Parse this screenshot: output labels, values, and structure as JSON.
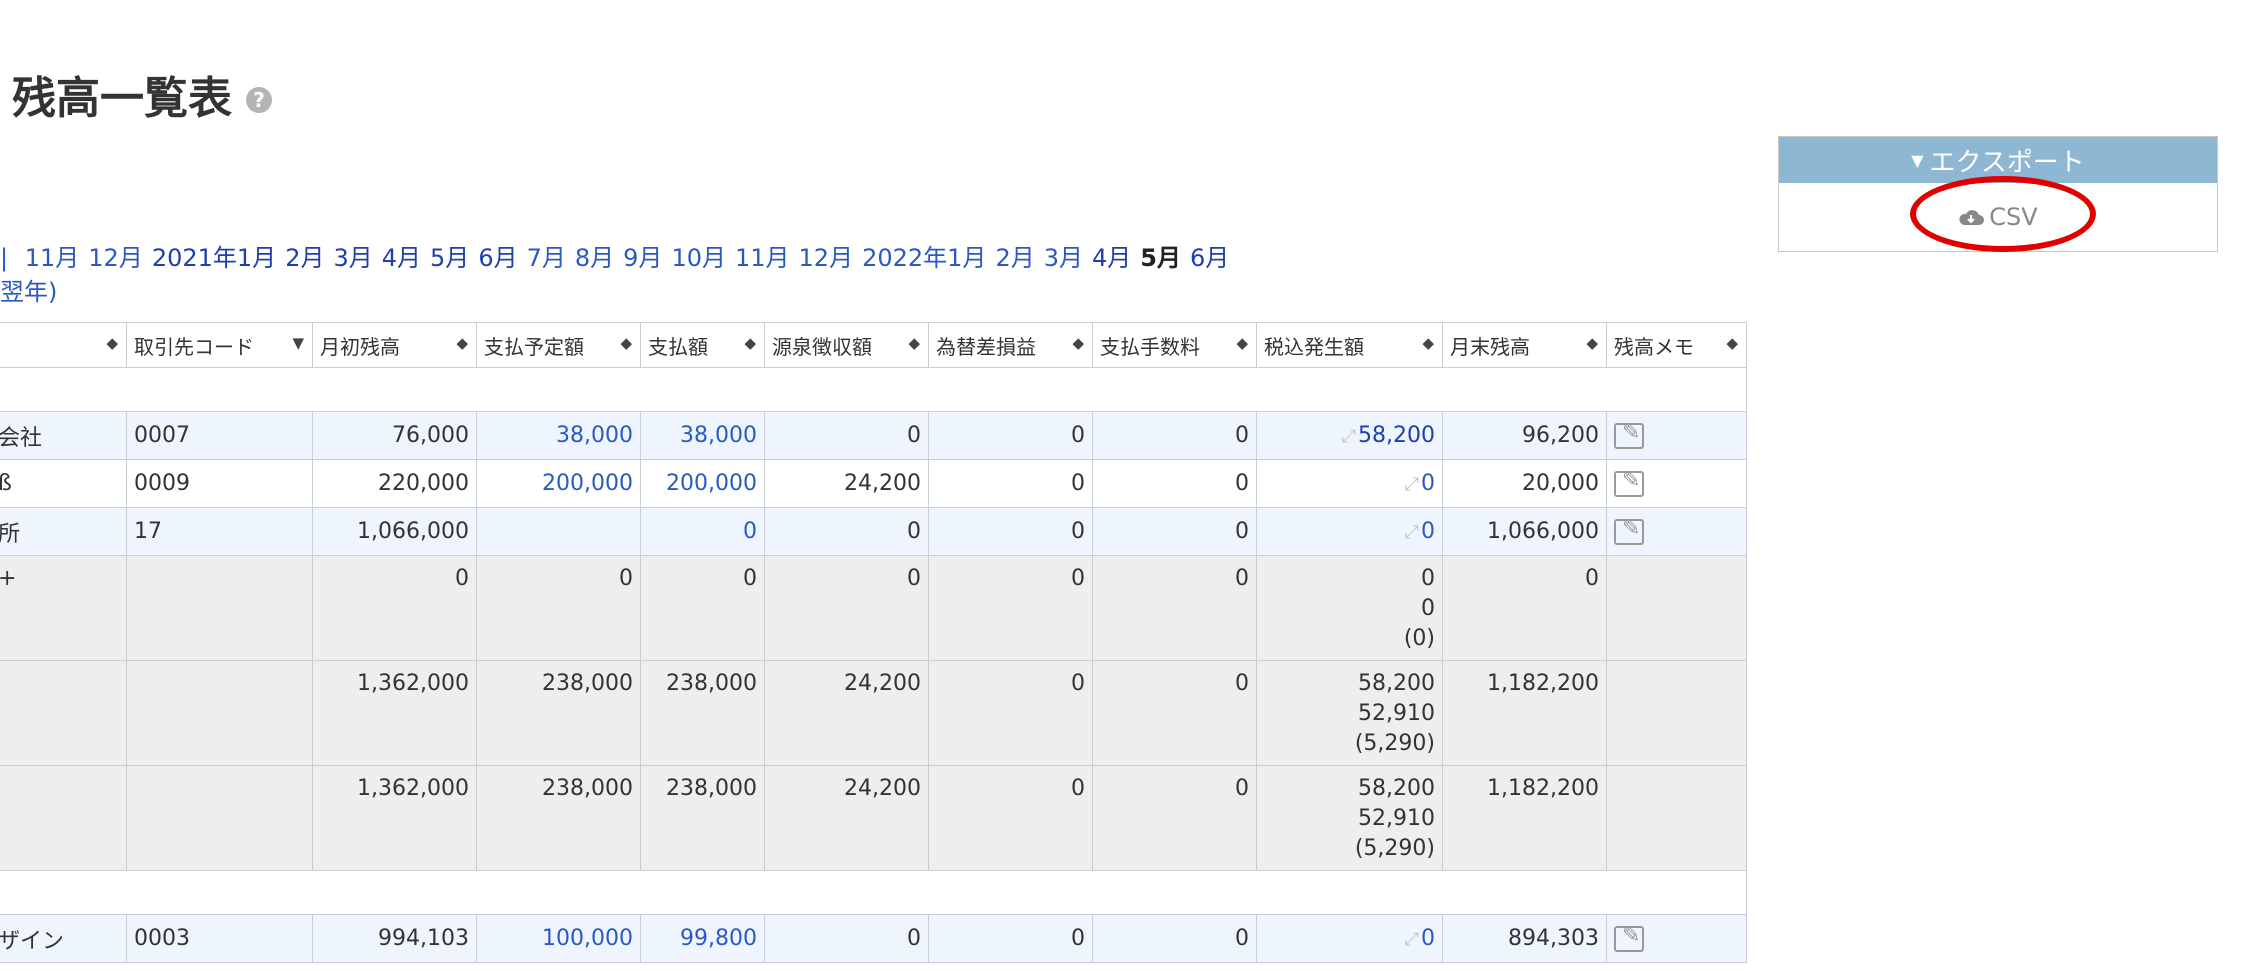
{
  "page": {
    "title": "残高一覧表",
    "help_icon": "?"
  },
  "export": {
    "header": "エクスポート",
    "csv_label": "CSV"
  },
  "months": [
    {
      "label": "11月",
      "style": "link"
    },
    {
      "label": "12月",
      "style": "link"
    },
    {
      "label": "2021年1月",
      "style": "dark"
    },
    {
      "label": "2月",
      "style": "dark"
    },
    {
      "label": "3月",
      "style": "dark"
    },
    {
      "label": "4月",
      "style": "dark"
    },
    {
      "label": "5月",
      "style": "dark"
    },
    {
      "label": "6月",
      "style": "dark"
    },
    {
      "label": "7月",
      "style": "link"
    },
    {
      "label": "8月",
      "style": "link"
    },
    {
      "label": "9月",
      "style": "link"
    },
    {
      "label": "10月",
      "style": "link"
    },
    {
      "label": "11月",
      "style": "link"
    },
    {
      "label": "12月",
      "style": "link"
    },
    {
      "label": "2022年1月",
      "style": "link"
    },
    {
      "label": "2月",
      "style": "link"
    },
    {
      "label": "3月",
      "style": "link"
    },
    {
      "label": "4月",
      "style": "dark"
    },
    {
      "label": "5月",
      "style": "current"
    },
    {
      "label": "6月",
      "style": "dark"
    }
  ],
  "months_prefix": "|",
  "subnote": "翌年)",
  "table": {
    "headers": [
      "",
      "取引先コード",
      "月初残高",
      "支払予定額",
      "支払額",
      "源泉徴収額",
      "為替差損益",
      "支払手数料",
      "税込発生額",
      "月末残高",
      "残高メモ"
    ],
    "sort_icons": [
      "◆",
      "▼",
      "◆",
      "◆",
      "◆",
      "◆",
      "◆",
      "◆",
      "◆",
      "◆",
      "◆"
    ],
    "rows": [
      {
        "type": "data",
        "bg": "blue",
        "name": "会社",
        "code": "0007",
        "open": "76,000",
        "planned": "38,000",
        "paid": "38,000",
        "withheld": "0",
        "fx": "0",
        "fee": "0",
        "tax": "58,200",
        "close": "96,200",
        "tax_link": true
      },
      {
        "type": "data",
        "bg": "white",
        "name": "ß",
        "code": "0009",
        "open": "220,000",
        "planned": "200,000",
        "paid": "200,000",
        "withheld": "24,200",
        "fx": "0",
        "fee": "0",
        "tax": "0",
        "close": "20,000",
        "tax_link": false
      },
      {
        "type": "data",
        "bg": "blue",
        "name": "所",
        "code": "17",
        "open": "1,066,000",
        "planned": "",
        "paid": "0",
        "withheld": "0",
        "fx": "0",
        "fee": "0",
        "tax": "0",
        "close": "1,066,000",
        "tax_link": false
      }
    ],
    "subtotal": {
      "name": "+",
      "open": "0",
      "planned": "0",
      "paid": "0",
      "withheld": "0",
      "fx": "0",
      "fee": "0",
      "tax_lines": [
        "0",
        "0",
        "(0)"
      ],
      "close": "0"
    },
    "total1": {
      "open": "1,362,000",
      "planned": "238,000",
      "paid": "238,000",
      "withheld": "24,200",
      "fx": "0",
      "fee": "0",
      "tax_lines": [
        "58,200",
        "52,910",
        "(5,290)"
      ],
      "close": "1,182,200"
    },
    "total2": {
      "open": "1,362,000",
      "planned": "238,000",
      "paid": "238,000",
      "withheld": "24,200",
      "fx": "0",
      "fee": "0",
      "tax_lines": [
        "58,200",
        "52,910",
        "(5,290)"
      ],
      "close": "1,182,200"
    },
    "last_row": {
      "name": "ザイン",
      "code": "0003",
      "open": "994,103",
      "planned": "100,000",
      "paid": "99,800",
      "withheld": "0",
      "fx": "0",
      "fee": "0",
      "tax": "0",
      "close": "894,303"
    }
  },
  "icons": {
    "help": "help-circle-icon",
    "export_caret": "caret-down-icon",
    "csv": "cloud-download-icon",
    "memo": "edit-memo-icon",
    "tax": "resize-arrow-icon"
  },
  "colors": {
    "accent": "#8db7d3",
    "link": "#2b59c3",
    "highlight": "#e00000"
  }
}
